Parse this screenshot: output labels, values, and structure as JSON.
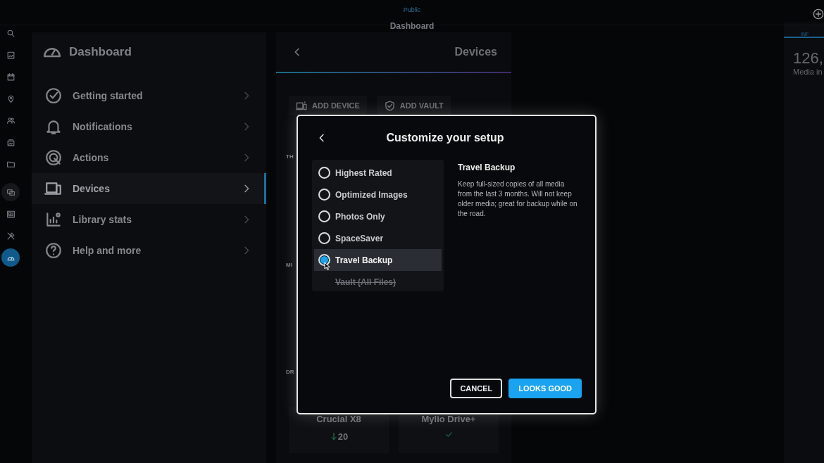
{
  "top_bar": {
    "subtitle": "Public",
    "title": "Dashboard"
  },
  "rail": {
    "items": [
      {
        "selected": false
      },
      {
        "selected": false
      },
      {
        "selected": false
      },
      {
        "selected": false
      },
      {
        "selected": false
      },
      {
        "selected": false
      },
      {
        "selected": false
      },
      {
        "selected": false
      },
      {
        "selected": false
      },
      {
        "selected": false
      },
      {
        "selected": true
      }
    ]
  },
  "dashboard_panel": {
    "title": "Dashboard",
    "items": [
      {
        "label": "Getting started",
        "selected": false
      },
      {
        "label": "Notifications",
        "selected": false
      },
      {
        "label": "Actions",
        "selected": false
      },
      {
        "label": "Devices",
        "selected": true
      },
      {
        "label": "Library stats",
        "selected": false
      },
      {
        "label": "Help and more",
        "selected": false
      }
    ]
  },
  "devices_panel": {
    "title": "Devices",
    "buttons": [
      {
        "label": "ADD DEVICE"
      },
      {
        "label": "ADD VAULT"
      }
    ],
    "section_labels": [
      "TH",
      "MI",
      "DR"
    ],
    "devices": [
      {
        "name": "Crucial X8",
        "kind": "count",
        "count": "20"
      },
      {
        "name": "Mylio Drive+",
        "kind": "synced"
      }
    ]
  },
  "info_panel": {
    "tab": "INF",
    "stat": "126,",
    "stat_label": "Media in"
  },
  "dialog": {
    "title": "Customize your setup",
    "options": [
      {
        "label": "Highest Rated",
        "selected": false,
        "disabled": false
      },
      {
        "label": "Optimized Images",
        "selected": false,
        "disabled": false
      },
      {
        "label": "Photos Only",
        "selected": false,
        "disabled": false
      },
      {
        "label": "SpaceSaver",
        "selected": false,
        "disabled": false
      },
      {
        "label": "Travel Backup",
        "selected": true,
        "disabled": false
      },
      {
        "label": "Vault (All Files)",
        "selected": false,
        "disabled": true
      }
    ],
    "detail": {
      "title": "Travel Backup",
      "text": "Keep full-sized copies of all media from the last 3 months. Will not keep older media; great for backup while on the road."
    },
    "buttons": [
      {
        "label": "CANCEL",
        "kind": "secondary"
      },
      {
        "label": "LOOKS GOOD",
        "kind": "primary"
      }
    ]
  }
}
